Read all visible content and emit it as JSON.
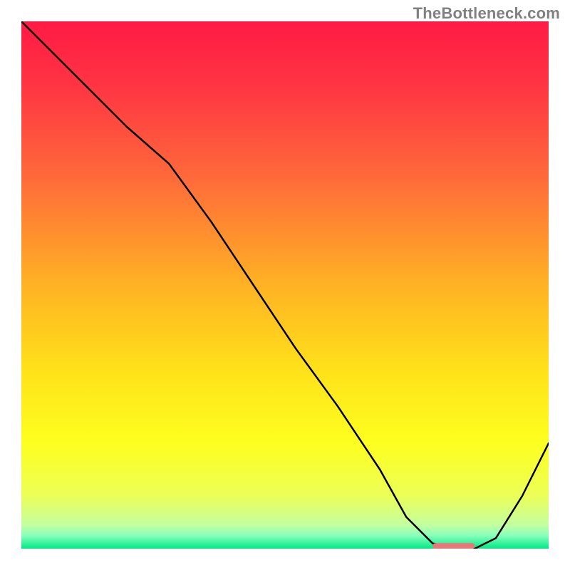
{
  "watermark": "TheBottleneck.com",
  "chart_data": {
    "type": "line",
    "title": "",
    "xlabel": "",
    "ylabel": "",
    "xlim": [
      0,
      100
    ],
    "ylim": [
      0,
      100
    ],
    "background_gradient_stops": [
      {
        "offset": 0.0,
        "color": "#ff1a45"
      },
      {
        "offset": 0.12,
        "color": "#ff3443"
      },
      {
        "offset": 0.3,
        "color": "#ff6b3a"
      },
      {
        "offset": 0.5,
        "color": "#ffb224"
      },
      {
        "offset": 0.66,
        "color": "#ffe11a"
      },
      {
        "offset": 0.8,
        "color": "#fdff1f"
      },
      {
        "offset": 0.9,
        "color": "#ecff57"
      },
      {
        "offset": 0.955,
        "color": "#c3ffa0"
      },
      {
        "offset": 0.975,
        "color": "#88ffbc"
      },
      {
        "offset": 1.0,
        "color": "#00e884"
      }
    ],
    "series": [
      {
        "name": "bottleneck-curve",
        "color": "#000000",
        "stroke_width": 2.5,
        "x": [
          0,
          10,
          20,
          28,
          36,
          44,
          52,
          60,
          68,
          73,
          78,
          83,
          86,
          90,
          95,
          100
        ],
        "values": [
          100,
          90,
          80,
          73,
          62,
          50,
          38,
          27,
          15,
          6,
          1,
          0,
          0,
          2,
          10,
          20
        ]
      }
    ],
    "marker": {
      "name": "optimal-range-marker",
      "color": "#e87878",
      "x_start": 78,
      "x_end": 86,
      "y": 0.5,
      "thickness": 8
    },
    "legend": null,
    "grid": false
  }
}
